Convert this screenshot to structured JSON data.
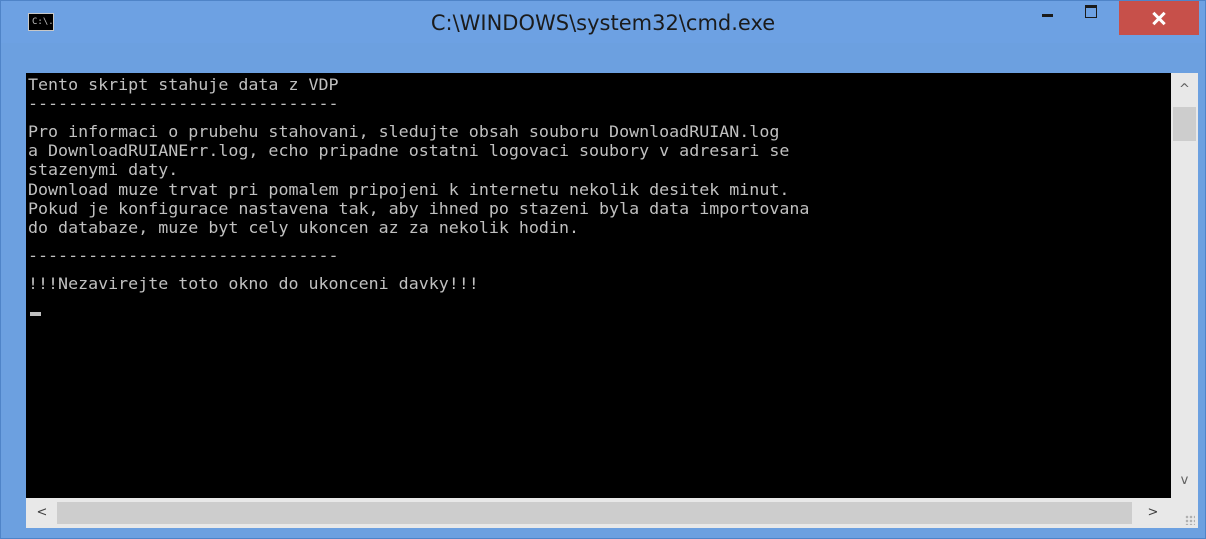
{
  "window": {
    "title": "C:\\WINDOWS\\system32\\cmd.exe",
    "icon": "cmd-icon",
    "icon_text": "C:\\.",
    "controls": [
      "minimize-icon",
      "maximize-icon",
      "close-icon"
    ]
  },
  "console": {
    "lines": [
      "Tento skript stahuje data z VDP",
      "-------------------------------",
      "Pro informaci o prubehu stahovani, sledujte obsah souboru DownloadRUIAN.log",
      "a DownloadRUIANErr.log, echo pripadne ostatni logovaci soubory v adresari se",
      "stazenymi daty.",
      "Download muze trvat pri pomalem pripojeni k internetu nekolik desitek minut.",
      "Pokud je konfigurace nastavena tak, aby ihned po stazeni byla data importovana",
      "do databaze, muze byt cely ukoncen az za nekolik hodin.",
      "-------------------------------",
      "!!!Nezavirejte toto okno do ukonceni davky!!!"
    ],
    "text_color": "#c0c0c0",
    "background": "#000000"
  },
  "scrollbars": {
    "up_arrow": "^",
    "down_arrow": "v",
    "left_arrow": "<",
    "right_arrow": ">"
  },
  "colors": {
    "titlebar": "#6da1e3",
    "close_button": "#c7504a"
  }
}
